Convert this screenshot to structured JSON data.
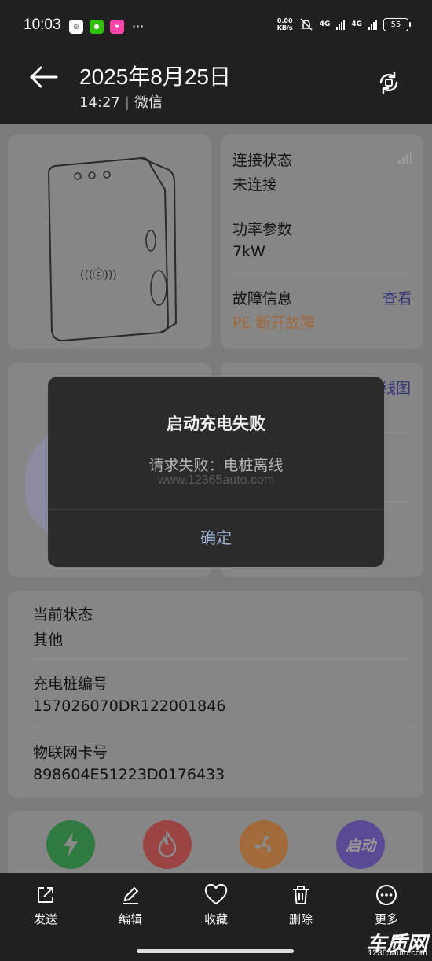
{
  "status_bar": {
    "time": "10:03",
    "app_icons": [
      "mobile-app-icon",
      "wechat-icon",
      "pink-app-icon"
    ],
    "more": "···",
    "speed_value": "0.00",
    "speed_unit": "KB/s",
    "network1": "4G",
    "network2": "4G",
    "battery": "55"
  },
  "titlebar": {
    "date": "2025年8月25日",
    "time": "14:27",
    "source": "微信"
  },
  "charger": {
    "connection_label": "连接状态",
    "connection_value": "未连接",
    "power_label": "功率参数",
    "power_value": "7kW",
    "fault_label": "故障信息",
    "fault_view": "查看",
    "fault_value": "PE 断开故障",
    "partial_link": "线图"
  },
  "info": {
    "state_label": "当前状态",
    "state_value": "其他",
    "pile_no_label": "充电桩编号",
    "pile_no_value": "157026070DR122001846",
    "iot_label": "物联网卡号",
    "iot_value": "898604E51223D0176433"
  },
  "actions": {
    "start_label": "启动"
  },
  "dialog": {
    "title": "启动充电失败",
    "message": "请求失败：电桩离线",
    "watermark": "www.12365auto.com",
    "ok": "确定"
  },
  "toolbar": {
    "send": "发送",
    "edit": "编辑",
    "favorite": "收藏",
    "delete": "删除",
    "more": "更多"
  },
  "watermark": {
    "logo": "车质网",
    "url": "12365auto.com"
  },
  "colors": {
    "dialog_bg": "#2b2b2b",
    "dialog_ok": "#9fb4d6",
    "green_action": "#2f7a41",
    "red_action": "#9a4444",
    "orange_action": "#a06a3a",
    "purple_action": "#5a4a94"
  }
}
